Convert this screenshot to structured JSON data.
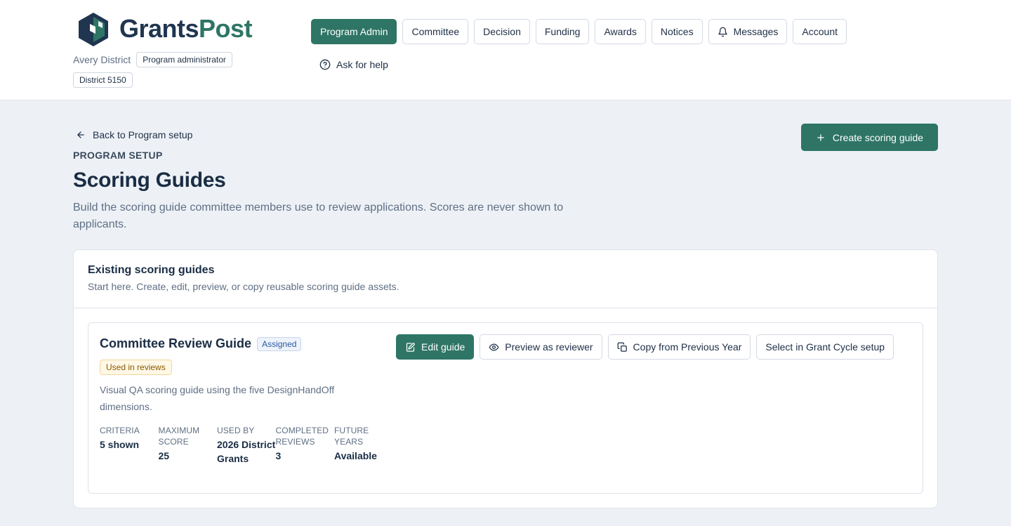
{
  "brand": {
    "part1": "Grants",
    "part2": "Post"
  },
  "org": {
    "name": "Avery District",
    "role": "Program administrator",
    "district": "District 5150"
  },
  "nav": {
    "items": [
      {
        "label": "Program Admin",
        "active": true
      },
      {
        "label": "Committee"
      },
      {
        "label": "Decision"
      },
      {
        "label": "Funding"
      },
      {
        "label": "Awards"
      },
      {
        "label": "Notices"
      },
      {
        "label": "Messages",
        "icon": "bell-icon"
      },
      {
        "label": "Account"
      }
    ],
    "help_label": "Ask for help"
  },
  "page": {
    "back_label": "Back to Program setup",
    "eyebrow": "PROGRAM SETUP",
    "title": "Scoring Guides",
    "subtitle": "Build the scoring guide committee members use to review applications. Scores are never shown to applicants.",
    "create_label": "Create scoring guide"
  },
  "panel": {
    "title": "Existing scoring guides",
    "subtitle": "Start here. Create, edit, preview, or copy reusable scoring guide assets."
  },
  "guide": {
    "name": "Committee Review Guide",
    "badge_assigned": "Assigned",
    "badge_used": "Used in reviews",
    "description": "Visual QA scoring guide using the five DesignHandOff dimensions.",
    "stats": [
      {
        "label": "CRITERIA",
        "value": "5 shown"
      },
      {
        "label": "MAXIMUM SCORE",
        "value": "25"
      },
      {
        "label": "USED BY",
        "value": "2026 District Grants"
      },
      {
        "label": "COMPLETED REVIEWS",
        "value": "3"
      },
      {
        "label": "FUTURE YEARS",
        "value": "Available"
      }
    ],
    "actions": {
      "edit": "Edit guide",
      "preview": "Preview as reviewer",
      "copy": "Copy from Previous Year",
      "select": "Select in Grant Cycle setup"
    }
  },
  "colors": {
    "primary": "#2e7565",
    "navy": "#1f3550",
    "background": "#edf1f6"
  }
}
